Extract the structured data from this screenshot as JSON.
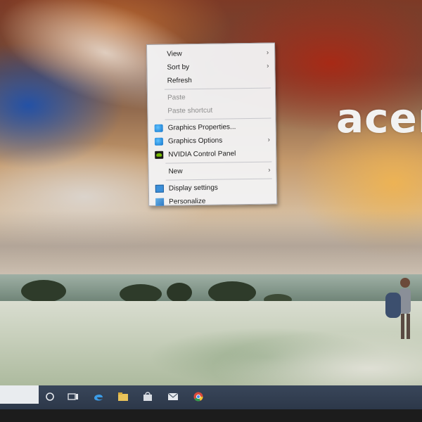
{
  "desktop": {
    "brand_logo_text": "acer"
  },
  "context_menu": {
    "items": [
      {
        "label": "View",
        "has_submenu": true,
        "enabled": true
      },
      {
        "label": "Sort by",
        "has_submenu": true,
        "enabled": true
      },
      {
        "label": "Refresh",
        "has_submenu": false,
        "enabled": true
      },
      {
        "label": "Paste",
        "has_submenu": false,
        "enabled": false
      },
      {
        "label": "Paste shortcut",
        "has_submenu": false,
        "enabled": false
      },
      {
        "label": "Graphics Properties...",
        "has_submenu": false,
        "enabled": true,
        "icon": "intel-graphics-icon"
      },
      {
        "label": "Graphics Options",
        "has_submenu": true,
        "enabled": true,
        "icon": "intel-graphics-icon"
      },
      {
        "label": "NVIDIA Control Panel",
        "has_submenu": false,
        "enabled": true,
        "icon": "nvidia-icon"
      },
      {
        "label": "New",
        "has_submenu": true,
        "enabled": true
      },
      {
        "label": "Display settings",
        "has_submenu": false,
        "enabled": true,
        "icon": "display-icon"
      },
      {
        "label": "Personalize",
        "has_submenu": false,
        "enabled": true,
        "icon": "personalize-icon"
      }
    ],
    "submenu_glyph": "›",
    "disabled_color": "#8d8d8d"
  },
  "taskbar": {
    "icons": [
      "search-circle-icon",
      "task-view-icon",
      "edge-icon",
      "file-explorer-icon",
      "store-icon",
      "mail-icon",
      "chrome-icon"
    ],
    "color": "#2b3647"
  }
}
